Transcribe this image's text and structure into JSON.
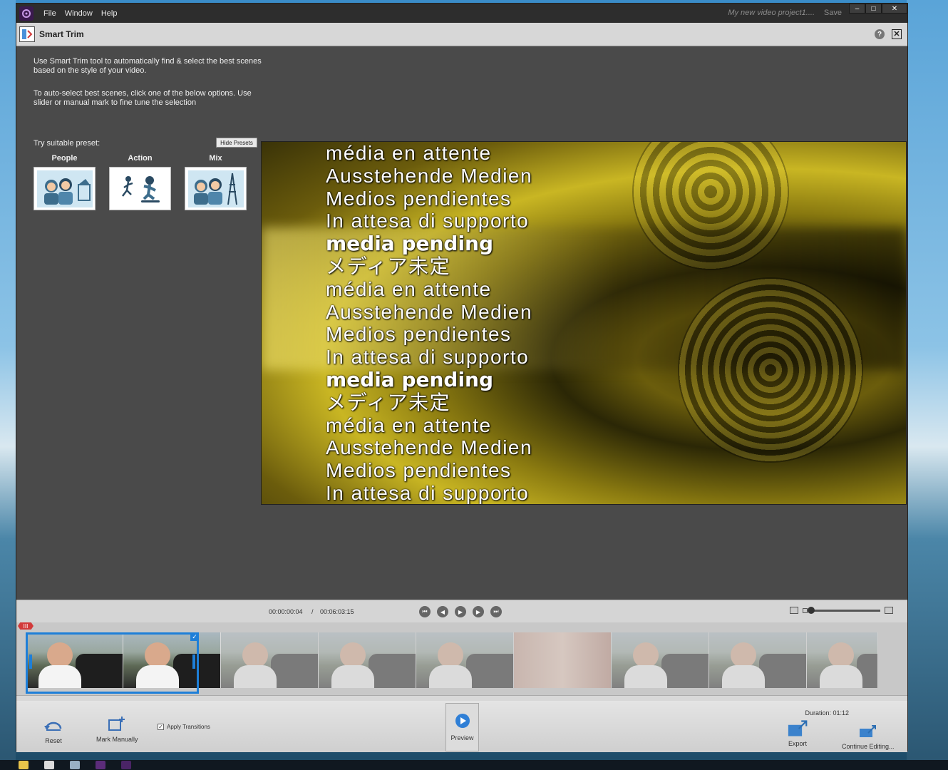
{
  "menubar": {
    "items": [
      "File",
      "Window",
      "Help"
    ],
    "project_name": "My new video project1....",
    "save_label": "Save",
    "window_controls": [
      "–",
      "□",
      "✕"
    ]
  },
  "panel": {
    "title": "Smart Trim",
    "help_label": "?",
    "close_label": "✕"
  },
  "description": {
    "para1": "Use Smart Trim tool to automatically find & select the best scenes based on the style of your video.",
    "para2": "To auto-select best scenes, click one of the below options. Use slider or manual mark to fine tune the selection"
  },
  "presets": {
    "label": "Try suitable preset:",
    "hide_label": "Hide Presets",
    "items": [
      {
        "name": "People"
      },
      {
        "name": "Action"
      },
      {
        "name": "Mix"
      }
    ]
  },
  "preview_lines": [
    "média en attente",
    "Ausstehende Medien",
    "Medios pendientes",
    "In attesa di supporto",
    "media pending",
    "メディア未定",
    "média en attente",
    "Ausstehende Medien",
    "Medios pendientes",
    "In attesa di supporto",
    "media pending",
    "メディア未定",
    "média en attente",
    "Ausstehende Medien",
    "Medios pendientes",
    "In attesa di supporto"
  ],
  "transport": {
    "current_time": "00:00:00:04",
    "separator": "/",
    "total_time": "00:06:03:15",
    "buttons": [
      "⏮",
      "◀",
      "▶",
      "▶",
      "⏭"
    ]
  },
  "timeline": {
    "playhead_label": "III",
    "selected_check": "✓"
  },
  "bottombar": {
    "reset_label": "Reset",
    "mark_manually_label": "Mark Manually",
    "apply_transitions_label": "Apply Transitions",
    "apply_transitions_checked": "✓",
    "preview_label": "Preview",
    "duration_label": "Duration: 01:12",
    "export_label": "Export",
    "continue_label": "Continue Editing..."
  },
  "colors": {
    "accent": "#1e7fd8",
    "panel_bg": "#4a4a4a",
    "playhead": "#d23a3a"
  }
}
